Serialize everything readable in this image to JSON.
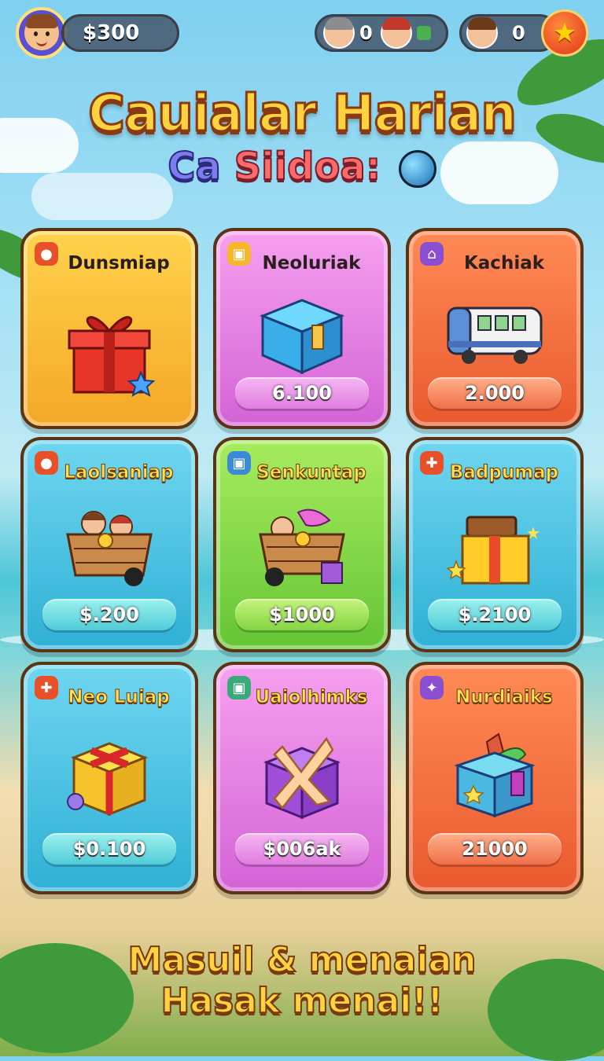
{
  "hud": {
    "coins": "$300",
    "friends_count": "0",
    "stars_count": "0"
  },
  "title": {
    "line1": "Cauialar Harian",
    "line2a": "Ca",
    "line2b": "Siidoa:"
  },
  "cards": [
    {
      "title": "Dunsmiap",
      "price": "",
      "color": "yellow"
    },
    {
      "title": "Neoluriak",
      "price": "6.100",
      "color": "pink"
    },
    {
      "title": "Kachiak",
      "price": "2.000",
      "color": "orange"
    },
    {
      "title": "Laolsaniap",
      "price": "$.200",
      "color": "cyan"
    },
    {
      "title": "Senkuntap",
      "price": "$1000",
      "color": "green"
    },
    {
      "title": "Badpumap",
      "price": "$.2100",
      "color": "cyan"
    },
    {
      "title": "Neo Luiap",
      "price": "$0.100",
      "color": "cyan"
    },
    {
      "title": "Uaiolhimks",
      "price": "$006ak",
      "color": "pink"
    },
    {
      "title": "Nurdiaiks",
      "price": "21000",
      "color": "orange"
    }
  ],
  "footer": {
    "line1": "Masuil & menaian",
    "line2": "Hasak menai!!"
  },
  "icons": {
    "star": "★",
    "globe": "globe-icon"
  }
}
